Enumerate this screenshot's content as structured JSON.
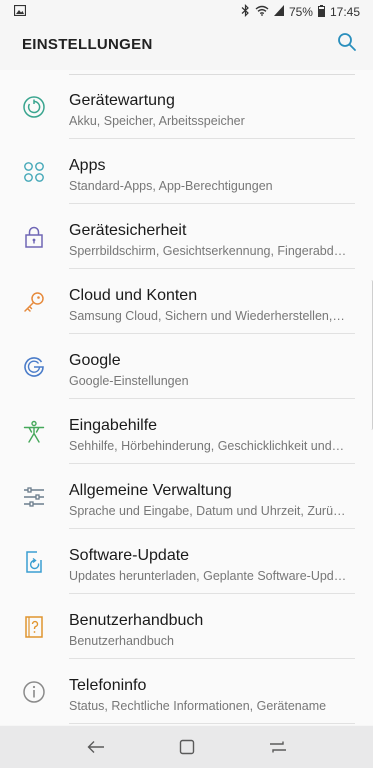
{
  "status_bar": {
    "battery_percent": "75%",
    "time": "17:45",
    "icons": [
      "gallery-notification-icon",
      "bluetooth-icon",
      "wifi-icon",
      "signal-icon",
      "battery-icon"
    ]
  },
  "header": {
    "title": "EINSTELLUNGEN",
    "search_icon": "search-icon",
    "accent_color": "#2a8fbd"
  },
  "items": [
    {
      "title": "Gerätewartung",
      "subtitle": "Akku, Speicher, Arbeitsspeicher",
      "icon": "device-maintenance-icon",
      "color": "#3aa58f"
    },
    {
      "title": "Apps",
      "subtitle": "Standard-Apps, App-Berechtigungen",
      "icon": "apps-icon",
      "color": "#45a8b8"
    },
    {
      "title": "Gerätesicherheit",
      "subtitle": "Sperrbildschirm, Gesichtserkennung, Fingerabd…",
      "icon": "lock-icon",
      "color": "#6f66b5"
    },
    {
      "title": "Cloud und Konten",
      "subtitle": "Samsung Cloud, Sichern und Wiederherstellen,…",
      "icon": "key-icon",
      "color": "#e68a3c"
    },
    {
      "title": "Google",
      "subtitle": "Google-Einstellungen",
      "icon": "google-icon",
      "color": "#4a7cc9"
    },
    {
      "title": "Eingabehilfe",
      "subtitle": "Sehhilfe, Hörbehinderung, Geschicklichkeit und…",
      "icon": "accessibility-icon",
      "color": "#45a85a"
    },
    {
      "title": "Allgemeine Verwaltung",
      "subtitle": "Sprache und Eingabe, Datum und Uhrzeit, Zurü…",
      "icon": "sliders-icon",
      "color": "#6b7d8c"
    },
    {
      "title": "Software-Update",
      "subtitle": "Updates herunterladen, Geplante Software-Upd…",
      "icon": "software-update-icon",
      "color": "#3a9ed1"
    },
    {
      "title": "Benutzerhandbuch",
      "subtitle": "Benutzerhandbuch",
      "icon": "user-manual-icon",
      "color": "#e0942e"
    },
    {
      "title": "Telefoninfo",
      "subtitle": "Status, Rechtliche Informationen, Gerätename",
      "icon": "info-icon",
      "color": "#8a8a8a"
    }
  ],
  "nav_bar": {
    "icons": [
      "back-icon",
      "home-icon",
      "recent-apps-icon"
    ]
  }
}
